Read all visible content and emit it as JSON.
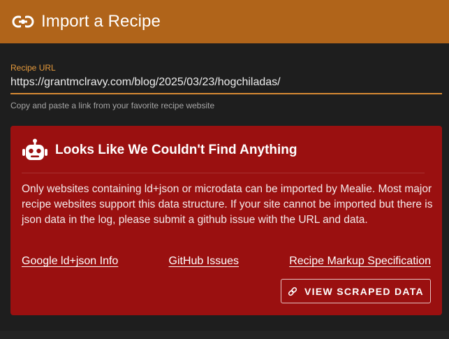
{
  "header": {
    "icon": "link-icon",
    "title": "Import a Recipe",
    "color": "#b0641a"
  },
  "url_field": {
    "label": "Recipe URL",
    "value": "https://grantmclravy.com/blog/2025/03/23/hogchiladas/",
    "hint": "Copy and paste a link from your favorite recipe website",
    "accent": "#d88a34"
  },
  "alert": {
    "icon": "robot-icon",
    "title": "Looks Like We Couldn't Find Anything",
    "body": "Only websites containing ld+json or microdata can be imported by Mealie. Most major recipe websites support this data structure. If your site cannot be imported but there is json data in the log, please submit a github issue with the URL and data.",
    "color": "#9a1010",
    "links": [
      {
        "label": "Google ld+json Info"
      },
      {
        "label": "GitHub Issues"
      },
      {
        "label": "Recipe Markup Specification"
      }
    ],
    "button": {
      "icon": "link-icon",
      "label": "VIEW SCRAPED DATA"
    }
  }
}
